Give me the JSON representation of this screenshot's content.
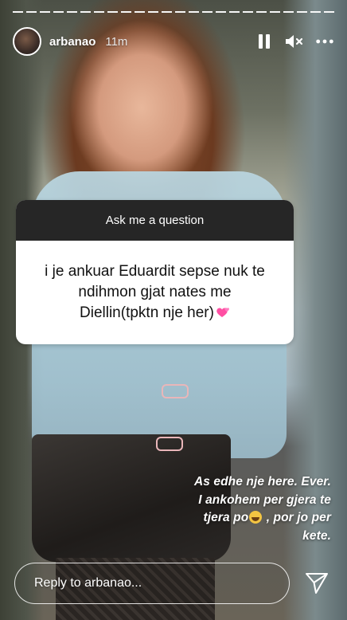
{
  "header": {
    "username": "arbanao",
    "time_ago": "11m",
    "icons": [
      "pause-icon",
      "mute-icon",
      "more-icon"
    ]
  },
  "question_sticker": {
    "title": "Ask me a question",
    "answer_line1": "i je ankuar Eduardit sepse nuk te",
    "answer_line2": "ndihmon gjat nates me",
    "answer_line3": "Diellin(tpktn nje her)"
  },
  "caption": {
    "line1": "As edhe nje here. Ever.",
    "line2": "I ankohem per gjera te",
    "line3_before": "tjera po",
    "line3_after": " , por jo per",
    "line4": "kete."
  },
  "reply": {
    "placeholder": "Reply to arbanao..."
  },
  "colors": {
    "sticker_header": "#262626",
    "sticker_body": "#ffffff",
    "text_white": "#ffffff"
  }
}
